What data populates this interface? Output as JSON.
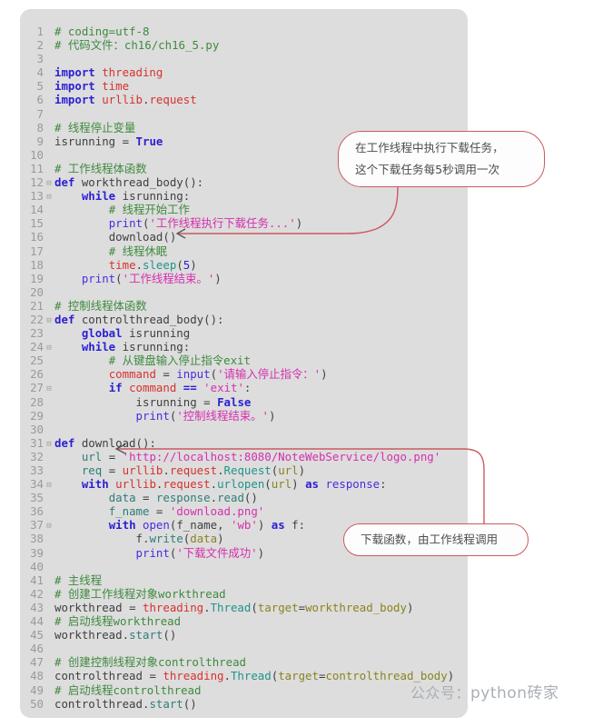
{
  "editor": {
    "background_color": "#dddddd",
    "page_background": "#ffffff",
    "gutter_color": "#9a9a9a",
    "first_line_number": 1,
    "last_line_number": 50,
    "language": "python",
    "file_path_comment": "ch16/ch16_5.py"
  },
  "palette": {
    "comment": "#3f8a3f",
    "keyword": "#2b1fd4",
    "module": "#d6322e",
    "class_attr": "#20948b",
    "string": "#d62fae",
    "identifier": "#3f3f3f",
    "kwarg": "#8a8320",
    "annotation_border": "#cc5a5f",
    "annotation_text": "#4d4d4d",
    "watermark": "#a9afb6"
  },
  "code": [
    {
      "n": 1,
      "fold": "",
      "indent": 0,
      "tokens": [
        {
          "t": "# coding=utf-8",
          "c": "t-com"
        }
      ]
    },
    {
      "n": 2,
      "fold": "",
      "indent": 0,
      "tokens": [
        {
          "t": "# 代码文件：ch16/ch16_5.py",
          "c": "t-com"
        }
      ]
    },
    {
      "n": 3,
      "fold": "",
      "indent": 0,
      "tokens": []
    },
    {
      "n": 4,
      "fold": "",
      "indent": 0,
      "tokens": [
        {
          "t": "import ",
          "c": "t-kw"
        },
        {
          "t": "threading",
          "c": "t-mod"
        }
      ]
    },
    {
      "n": 5,
      "fold": "",
      "indent": 0,
      "tokens": [
        {
          "t": "import ",
          "c": "t-kw"
        },
        {
          "t": "time",
          "c": "t-mod"
        }
      ]
    },
    {
      "n": 6,
      "fold": "",
      "indent": 0,
      "tokens": [
        {
          "t": "import ",
          "c": "t-kw"
        },
        {
          "t": "urllib",
          "c": "t-mod"
        },
        {
          "t": ".",
          "c": "t-op"
        },
        {
          "t": "request",
          "c": "t-mod"
        }
      ]
    },
    {
      "n": 7,
      "fold": "",
      "indent": 0,
      "tokens": []
    },
    {
      "n": 8,
      "fold": "",
      "indent": 0,
      "tokens": [
        {
          "t": "# 线程停止变量",
          "c": "t-com"
        }
      ]
    },
    {
      "n": 9,
      "fold": "",
      "indent": 0,
      "tokens": [
        {
          "t": "isrunning ",
          "c": "t-var"
        },
        {
          "t": "= ",
          "c": "t-op"
        },
        {
          "t": "True",
          "c": "t-kw"
        }
      ]
    },
    {
      "n": 10,
      "fold": "",
      "indent": 0,
      "tokens": []
    },
    {
      "n": 11,
      "fold": "",
      "indent": 0,
      "tokens": [
        {
          "t": "# 工作线程体函数",
          "c": "t-com"
        }
      ]
    },
    {
      "n": 12,
      "fold": "-",
      "indent": 0,
      "tokens": [
        {
          "t": "def ",
          "c": "t-kw"
        },
        {
          "t": "workthread_body",
          "c": "t-var"
        },
        {
          "t": "():",
          "c": "t-op"
        }
      ]
    },
    {
      "n": 13,
      "fold": "-",
      "indent": 1,
      "tokens": [
        {
          "t": "while ",
          "c": "t-kw"
        },
        {
          "t": "isrunning",
          "c": "t-var"
        },
        {
          "t": ":",
          "c": "t-op"
        }
      ]
    },
    {
      "n": 14,
      "fold": "",
      "indent": 2,
      "tokens": [
        {
          "t": "# 线程开始工作",
          "c": "t-com"
        }
      ]
    },
    {
      "n": 15,
      "fold": "",
      "indent": 2,
      "tokens": [
        {
          "t": "print",
          "c": "t-kw2"
        },
        {
          "t": "(",
          "c": "t-op"
        },
        {
          "t": "'工作线程执行下载任务...'",
          "c": "t-str"
        },
        {
          "t": ")",
          "c": "t-op"
        }
      ]
    },
    {
      "n": 16,
      "fold": "",
      "indent": 2,
      "tokens": [
        {
          "t": "download",
          "c": "t-var"
        },
        {
          "t": "()",
          "c": "t-op"
        }
      ]
    },
    {
      "n": 17,
      "fold": "",
      "indent": 2,
      "tokens": [
        {
          "t": "# 线程休眠",
          "c": "t-com"
        }
      ]
    },
    {
      "n": 18,
      "fold": "",
      "indent": 2,
      "tokens": [
        {
          "t": "time",
          "c": "t-mod"
        },
        {
          "t": ".",
          "c": "t-op"
        },
        {
          "t": "sleep",
          "c": "t-cls"
        },
        {
          "t": "(",
          "c": "t-op"
        },
        {
          "t": "5",
          "c": "t-num"
        },
        {
          "t": ")",
          "c": "t-op"
        }
      ]
    },
    {
      "n": 19,
      "fold": "",
      "indent": 1,
      "tokens": [
        {
          "t": "print",
          "c": "t-kw2"
        },
        {
          "t": "(",
          "c": "t-op"
        },
        {
          "t": "'工作线程结束。'",
          "c": "t-str"
        },
        {
          "t": ")",
          "c": "t-op"
        }
      ]
    },
    {
      "n": 20,
      "fold": "",
      "indent": 0,
      "tokens": []
    },
    {
      "n": 21,
      "fold": "",
      "indent": 0,
      "tokens": [
        {
          "t": "# 控制线程体函数",
          "c": "t-com"
        }
      ]
    },
    {
      "n": 22,
      "fold": "-",
      "indent": 0,
      "tokens": [
        {
          "t": "def ",
          "c": "t-kw"
        },
        {
          "t": "controlthread_body",
          "c": "t-var"
        },
        {
          "t": "():",
          "c": "t-op"
        }
      ]
    },
    {
      "n": 23,
      "fold": "",
      "indent": 1,
      "tokens": [
        {
          "t": "global ",
          "c": "t-kw"
        },
        {
          "t": "isrunning",
          "c": "t-var"
        }
      ]
    },
    {
      "n": 24,
      "fold": "-",
      "indent": 1,
      "tokens": [
        {
          "t": "while ",
          "c": "t-kw"
        },
        {
          "t": "isrunning",
          "c": "t-var"
        },
        {
          "t": ":",
          "c": "t-op"
        }
      ]
    },
    {
      "n": 25,
      "fold": "",
      "indent": 2,
      "tokens": [
        {
          "t": "# 从键盘输入停止指令exit",
          "c": "t-com"
        }
      ]
    },
    {
      "n": 26,
      "fold": "",
      "indent": 2,
      "tokens": [
        {
          "t": "command ",
          "c": "t-mod"
        },
        {
          "t": "= ",
          "c": "t-op"
        },
        {
          "t": "input",
          "c": "t-kw2"
        },
        {
          "t": "(",
          "c": "t-op"
        },
        {
          "t": "'请输入停止指令：'",
          "c": "t-str"
        },
        {
          "t": ")",
          "c": "t-op"
        }
      ]
    },
    {
      "n": 27,
      "fold": "-",
      "indent": 2,
      "tokens": [
        {
          "t": "if ",
          "c": "t-kw"
        },
        {
          "t": "command ",
          "c": "t-mod"
        },
        {
          "t": "== ",
          "c": "t-kw"
        },
        {
          "t": "'exit'",
          "c": "t-str"
        },
        {
          "t": ":",
          "c": "t-op"
        }
      ]
    },
    {
      "n": 28,
      "fold": "",
      "indent": 3,
      "tokens": [
        {
          "t": "isrunning ",
          "c": "t-var"
        },
        {
          "t": "= ",
          "c": "t-op"
        },
        {
          "t": "False",
          "c": "t-kw"
        }
      ]
    },
    {
      "n": 29,
      "fold": "",
      "indent": 3,
      "tokens": [
        {
          "t": "print",
          "c": "t-kw2"
        },
        {
          "t": "(",
          "c": "t-op"
        },
        {
          "t": "'控制线程结束。'",
          "c": "t-str"
        },
        {
          "t": ")",
          "c": "t-op"
        }
      ]
    },
    {
      "n": 30,
      "fold": "",
      "indent": 0,
      "tokens": []
    },
    {
      "n": 31,
      "fold": "-",
      "indent": 0,
      "tokens": [
        {
          "t": "def ",
          "c": "t-kw"
        },
        {
          "t": "download",
          "c": "t-var"
        },
        {
          "t": "():",
          "c": "t-op"
        }
      ]
    },
    {
      "n": 32,
      "fold": "",
      "indent": 1,
      "tokens": [
        {
          "t": "url ",
          "c": "t-tealv"
        },
        {
          "t": "= ",
          "c": "t-op"
        },
        {
          "t": "'http://localhost:8080/NoteWebService/logo.png'",
          "c": "t-str"
        }
      ]
    },
    {
      "n": 33,
      "fold": "",
      "indent": 1,
      "tokens": [
        {
          "t": "req ",
          "c": "t-tealv"
        },
        {
          "t": "= ",
          "c": "t-op"
        },
        {
          "t": "urllib",
          "c": "t-mod"
        },
        {
          "t": ".",
          "c": "t-op"
        },
        {
          "t": "request",
          "c": "t-mod"
        },
        {
          "t": ".",
          "c": "t-op"
        },
        {
          "t": "Request",
          "c": "t-cls"
        },
        {
          "t": "(",
          "c": "t-op"
        },
        {
          "t": "url",
          "c": "t-kwarg"
        },
        {
          "t": ")",
          "c": "t-op"
        }
      ]
    },
    {
      "n": 34,
      "fold": "-",
      "indent": 1,
      "tokens": [
        {
          "t": "with ",
          "c": "t-kw"
        },
        {
          "t": "urllib",
          "c": "t-mod"
        },
        {
          "t": ".",
          "c": "t-op"
        },
        {
          "t": "request",
          "c": "t-mod"
        },
        {
          "t": ".",
          "c": "t-op"
        },
        {
          "t": "urlopen",
          "c": "t-cls"
        },
        {
          "t": "(",
          "c": "t-op"
        },
        {
          "t": "url",
          "c": "t-kwarg"
        },
        {
          "t": ") ",
          "c": "t-op"
        },
        {
          "t": "as ",
          "c": "t-kw"
        },
        {
          "t": "response",
          "c": "t-kw2"
        },
        {
          "t": ":",
          "c": "t-op"
        }
      ]
    },
    {
      "n": 35,
      "fold": "",
      "indent": 2,
      "tokens": [
        {
          "t": "data ",
          "c": "t-tealv"
        },
        {
          "t": "= ",
          "c": "t-op"
        },
        {
          "t": "response",
          "c": "t-tealv"
        },
        {
          "t": ".",
          "c": "t-op"
        },
        {
          "t": "read",
          "c": "t-tealv"
        },
        {
          "t": "()",
          "c": "t-op"
        }
      ]
    },
    {
      "n": 36,
      "fold": "",
      "indent": 2,
      "tokens": [
        {
          "t": "f_name ",
          "c": "t-tealv"
        },
        {
          "t": "= ",
          "c": "t-op"
        },
        {
          "t": "'download.png'",
          "c": "t-str"
        }
      ]
    },
    {
      "n": 37,
      "fold": "-",
      "indent": 2,
      "tokens": [
        {
          "t": "with ",
          "c": "t-kw"
        },
        {
          "t": "open",
          "c": "t-kw2"
        },
        {
          "t": "(",
          "c": "t-op"
        },
        {
          "t": "f_name",
          "c": "t-var"
        },
        {
          "t": ", ",
          "c": "t-op"
        },
        {
          "t": "'wb'",
          "c": "t-str"
        },
        {
          "t": ") ",
          "c": "t-op"
        },
        {
          "t": "as ",
          "c": "t-kw"
        },
        {
          "t": "f",
          "c": "t-var"
        },
        {
          "t": ":",
          "c": "t-op"
        }
      ]
    },
    {
      "n": 38,
      "fold": "",
      "indent": 3,
      "tokens": [
        {
          "t": "f",
          "c": "t-var"
        },
        {
          "t": ".",
          "c": "t-op"
        },
        {
          "t": "write",
          "c": "t-tealv"
        },
        {
          "t": "(",
          "c": "t-op"
        },
        {
          "t": "data",
          "c": "t-kwarg"
        },
        {
          "t": ")",
          "c": "t-op"
        }
      ]
    },
    {
      "n": 39,
      "fold": "",
      "indent": 3,
      "tokens": [
        {
          "t": "print",
          "c": "t-kw2"
        },
        {
          "t": "(",
          "c": "t-op"
        },
        {
          "t": "'下载文件成功'",
          "c": "t-str"
        },
        {
          "t": ")",
          "c": "t-op"
        }
      ]
    },
    {
      "n": 40,
      "fold": "",
      "indent": 0,
      "tokens": []
    },
    {
      "n": 41,
      "fold": "",
      "indent": 0,
      "tokens": [
        {
          "t": "# 主线程",
          "c": "t-com"
        }
      ]
    },
    {
      "n": 42,
      "fold": "",
      "indent": 0,
      "tokens": [
        {
          "t": "# 创建工作线程对象workthread",
          "c": "t-com"
        }
      ]
    },
    {
      "n": 43,
      "fold": "",
      "indent": 0,
      "tokens": [
        {
          "t": "workthread ",
          "c": "t-var"
        },
        {
          "t": "= ",
          "c": "t-op"
        },
        {
          "t": "threading",
          "c": "t-mod"
        },
        {
          "t": ".",
          "c": "t-op"
        },
        {
          "t": "Thread",
          "c": "t-cls"
        },
        {
          "t": "(",
          "c": "t-op"
        },
        {
          "t": "target",
          "c": "t-kwarg"
        },
        {
          "t": "=",
          "c": "t-op"
        },
        {
          "t": "workthread_body",
          "c": "t-kwarg"
        },
        {
          "t": ")",
          "c": "t-op"
        }
      ]
    },
    {
      "n": 44,
      "fold": "",
      "indent": 0,
      "tokens": [
        {
          "t": "# 启动线程workthread",
          "c": "t-com"
        }
      ]
    },
    {
      "n": 45,
      "fold": "",
      "indent": 0,
      "tokens": [
        {
          "t": "workthread",
          "c": "t-var"
        },
        {
          "t": ".",
          "c": "t-op"
        },
        {
          "t": "start",
          "c": "t-tealv"
        },
        {
          "t": "()",
          "c": "t-op"
        }
      ]
    },
    {
      "n": 46,
      "fold": "",
      "indent": 0,
      "tokens": []
    },
    {
      "n": 47,
      "fold": "",
      "indent": 0,
      "tokens": [
        {
          "t": "# 创建控制线程对象controlthread",
          "c": "t-com"
        }
      ]
    },
    {
      "n": 48,
      "fold": "",
      "indent": 0,
      "tokens": [
        {
          "t": "controlthread ",
          "c": "t-var"
        },
        {
          "t": "= ",
          "c": "t-op"
        },
        {
          "t": "threading",
          "c": "t-mod"
        },
        {
          "t": ".",
          "c": "t-op"
        },
        {
          "t": "Thread",
          "c": "t-cls"
        },
        {
          "t": "(",
          "c": "t-op"
        },
        {
          "t": "target",
          "c": "t-kwarg"
        },
        {
          "t": "=",
          "c": "t-op"
        },
        {
          "t": "controlthread_body",
          "c": "t-kwarg"
        },
        {
          "t": ")",
          "c": "t-op"
        }
      ]
    },
    {
      "n": 49,
      "fold": "",
      "indent": 0,
      "tokens": [
        {
          "t": "# 启动线程controlthread",
          "c": "t-com"
        }
      ]
    },
    {
      "n": 50,
      "fold": "",
      "indent": 0,
      "tokens": [
        {
          "t": "controlthread",
          "c": "t-var"
        },
        {
          "t": ".",
          "c": "t-op"
        },
        {
          "t": "start",
          "c": "t-tealv"
        },
        {
          "t": "()",
          "c": "t-op"
        }
      ]
    }
  ],
  "annotations": [
    {
      "id": "callout-1",
      "lines": [
        "在工作线程中执行下载任务，",
        "这个下载任务每5秒调用一次"
      ],
      "points_to_line": 16,
      "points_to_code": "download()"
    },
    {
      "id": "callout-2",
      "lines": [
        "下载函数，由工作线程调用"
      ],
      "points_to_line": 31,
      "points_to_code": "def download():"
    }
  ],
  "watermark": {
    "prefix": "公众号：",
    "name": "python砖家"
  }
}
